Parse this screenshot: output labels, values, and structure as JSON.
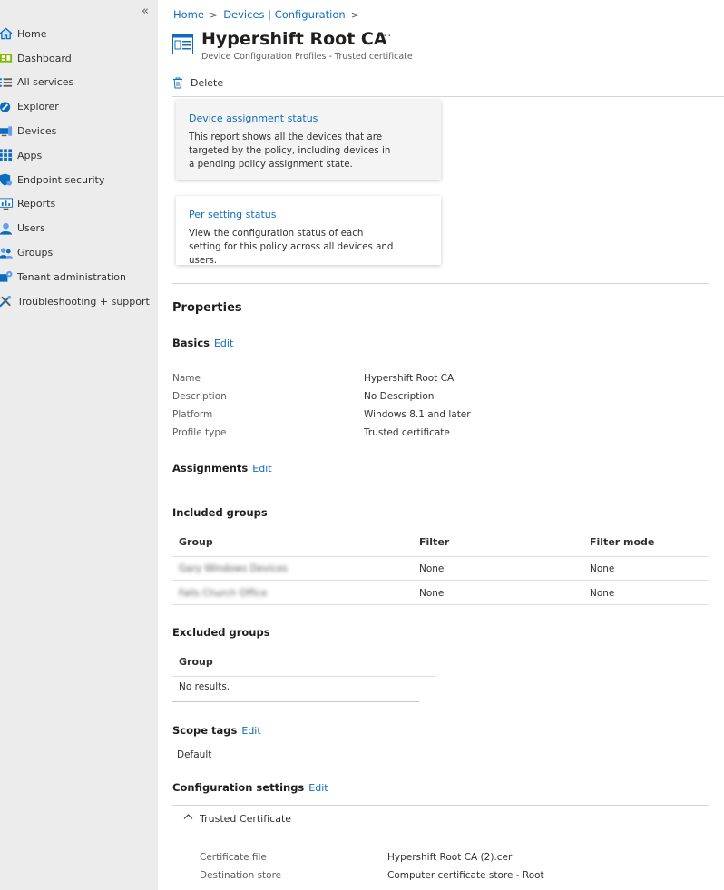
{
  "sidebar": {
    "collapse_glyph": "«",
    "items": [
      {
        "label": "Home",
        "icon": "home-icon"
      },
      {
        "label": "Dashboard",
        "icon": "dashboard-icon"
      },
      {
        "label": "All services",
        "icon": "list-icon"
      },
      {
        "label": "Explorer",
        "icon": "explorer-icon"
      },
      {
        "label": "Devices",
        "icon": "devices-icon"
      },
      {
        "label": "Apps",
        "icon": "apps-grid-icon"
      },
      {
        "label": "Endpoint security",
        "icon": "shield-icon"
      },
      {
        "label": "Reports",
        "icon": "reports-icon"
      },
      {
        "label": "Users",
        "icon": "user-icon"
      },
      {
        "label": "Groups",
        "icon": "groups-icon"
      },
      {
        "label": "Tenant administration",
        "icon": "tenant-admin-icon"
      },
      {
        "label": "Troubleshooting + support",
        "icon": "tools-icon"
      }
    ]
  },
  "breadcrumb": {
    "items": [
      "Home",
      "Devices | Configuration"
    ],
    "separator": ">"
  },
  "header": {
    "title": "Hypershift Root CA",
    "more": "···",
    "subtitle": "Device Configuration Profiles - Trusted certificate"
  },
  "toolbar": {
    "delete_label": "Delete"
  },
  "cards": {
    "assignment": {
      "title": "Device assignment status",
      "desc": "This report shows all the devices that are targeted by the policy, including devices in a pending policy assignment state."
    },
    "per_setting": {
      "title": "Per setting status",
      "desc": "View the configuration status of each setting for this policy across all devices and users."
    }
  },
  "properties": {
    "heading": "Properties",
    "edit_label": "Edit",
    "basics": {
      "heading": "Basics",
      "rows": [
        {
          "label": "Name",
          "value": "Hypershift Root CA"
        },
        {
          "label": "Description",
          "value": "No Description"
        },
        {
          "label": "Platform",
          "value": "Windows 8.1 and later"
        },
        {
          "label": "Profile type",
          "value": "Trusted certificate"
        }
      ]
    },
    "assignments": {
      "heading": "Assignments"
    },
    "included": {
      "heading": "Included groups",
      "columns": [
        "Group",
        "Filter",
        "Filter mode"
      ],
      "rows": [
        [
          "Gary Windows Devices",
          "None",
          "None"
        ],
        [
          "Falls Church Office",
          "None",
          "None"
        ]
      ]
    },
    "excluded": {
      "heading": "Excluded groups",
      "columns": [
        "Group"
      ],
      "empty": "No results."
    },
    "scope": {
      "heading": "Scope tags",
      "value": "Default"
    },
    "config": {
      "heading": "Configuration settings",
      "group_title": "Trusted Certificate",
      "rows": [
        {
          "label": "Certificate file",
          "value": "Hypershift Root CA (2).cer"
        },
        {
          "label": "Destination store",
          "value": "Computer certificate store - Root"
        }
      ]
    }
  },
  "colors": {
    "link": "#0f6cbd",
    "sidebar_bg": "#ececec",
    "text": "#323130",
    "muted": "#605e5c"
  }
}
